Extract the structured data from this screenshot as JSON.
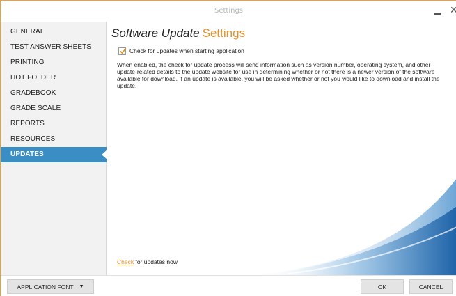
{
  "window": {
    "title": "Settings"
  },
  "sidebar": {
    "items": [
      {
        "label": "GENERAL",
        "active": false
      },
      {
        "label": "TEST ANSWER SHEETS",
        "active": false
      },
      {
        "label": "PRINTING",
        "active": false
      },
      {
        "label": "HOT FOLDER",
        "active": false
      },
      {
        "label": "GRADEBOOK",
        "active": false
      },
      {
        "label": "GRADE SCALE",
        "active": false
      },
      {
        "label": "REPORTS",
        "active": false
      },
      {
        "label": "RESOURCES",
        "active": false
      },
      {
        "label": "UPDATES",
        "active": true
      }
    ]
  },
  "content": {
    "heading_main": "Software Update",
    "heading_accent": "Settings",
    "checkbox_label": "Check for updates when starting application",
    "checkbox_checked": true,
    "description": "When enabled, the check for update process will send information such as version number, operating system, and other update-related details to the update website for use in determining whether or not there is a newer version of the software available for download. If an update is available, you will be asked whether or not you would like to download and install the update.",
    "check_now_link": "Check",
    "check_now_text": " for updates now"
  },
  "footer": {
    "font_button": "APPLICATION FONT",
    "ok_button": "OK",
    "cancel_button": "CANCEL"
  },
  "colors": {
    "accent": "#e8922a",
    "active_nav": "#3a8ec4",
    "swoosh": "#2a6fb0"
  },
  "icons": [
    "minimize-icon",
    "close-icon",
    "checkmark-icon",
    "caret-down-icon"
  ]
}
